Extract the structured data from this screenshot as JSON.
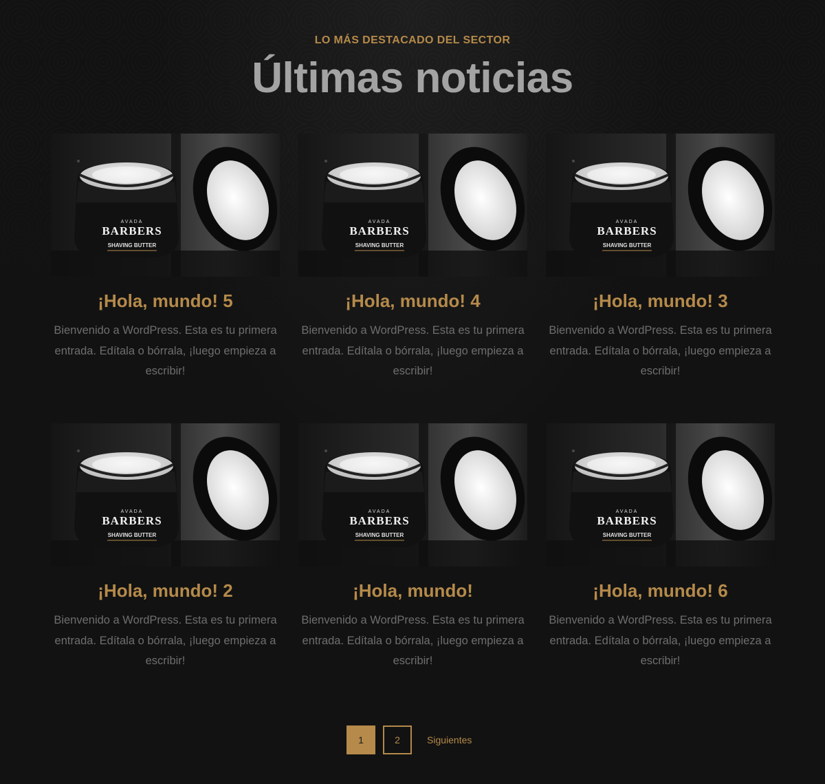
{
  "section": {
    "eyebrow": "LO MÁS DESTACADO DEL SECTOR",
    "heading": "Últimas noticias"
  },
  "posts": [
    {
      "title": "¡Hola, mundo! 5",
      "excerpt": "Bienvenido a WordPress. Esta es tu primera entrada. Edítala o bórrala, ¡luego empieza a escribir!",
      "image_brand": "AVADA",
      "image_name": "BARBERS",
      "image_product": "SHAVING BUTTER"
    },
    {
      "title": "¡Hola, mundo! 4",
      "excerpt": "Bienvenido a WordPress. Esta es tu primera entrada. Edítala o bórrala, ¡luego empieza a escribir!",
      "image_brand": "AVADA",
      "image_name": "BARBERS",
      "image_product": "SHAVING BUTTER"
    },
    {
      "title": "¡Hola, mundo! 3",
      "excerpt": "Bienvenido a WordPress. Esta es tu primera entrada. Edítala o bórrala, ¡luego empieza a escribir!",
      "image_brand": "AVADA",
      "image_name": "BARBERS",
      "image_product": "SHAVING BUTTER"
    },
    {
      "title": "¡Hola, mundo! 2",
      "excerpt": "Bienvenido a WordPress. Esta es tu primera entrada. Edítala o bórrala, ¡luego empieza a escribir!",
      "image_brand": "AVADA",
      "image_name": "BARBERS",
      "image_product": "SHAVING BUTTER"
    },
    {
      "title": "¡Hola, mundo!",
      "excerpt": "Bienvenido a WordPress. Esta es tu primera entrada. Edítala o bórrala, ¡luego empieza a escribir!",
      "image_brand": "AVADA",
      "image_name": "BARBERS",
      "image_product": "SHAVING BUTTER"
    },
    {
      "title": "¡Hola, mundo! 6",
      "excerpt": "Bienvenido a WordPress. Esta es tu primera entrada. Edítala o bórrala, ¡luego empieza a escribir!",
      "image_brand": "AVADA",
      "image_name": "BARBERS",
      "image_product": "SHAVING BUTTER"
    }
  ],
  "pagination": {
    "pages": [
      "1",
      "2"
    ],
    "current": "1",
    "next_label": "Siguientes"
  },
  "colors": {
    "accent": "#b58a4a",
    "background": "#121212",
    "heading": "#a3a3a3",
    "body_text": "#6e6e6e"
  }
}
